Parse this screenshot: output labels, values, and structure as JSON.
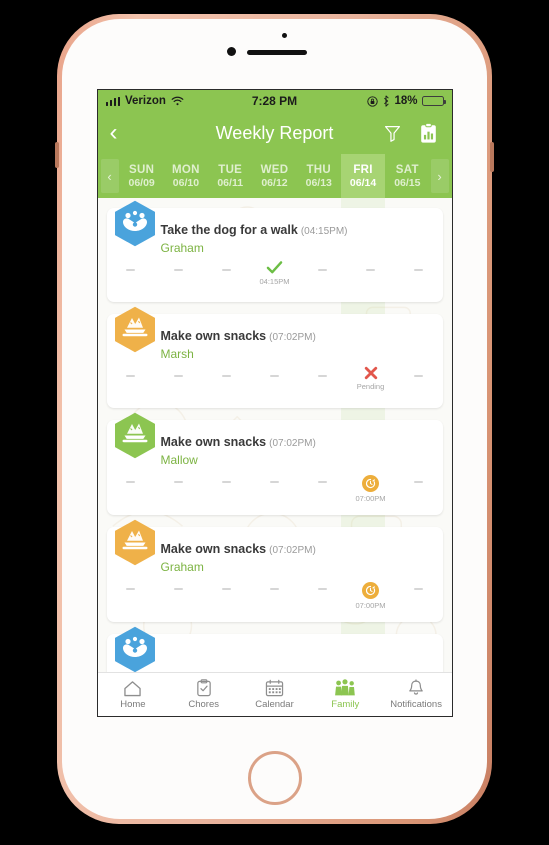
{
  "status_bar": {
    "carrier": "Verizon",
    "time": "7:28 PM",
    "battery_percent": "18%",
    "wifi_icon": "wifi-icon",
    "signal_icon": "signal-bars-icon",
    "rotation_lock_icon": "rotation-lock-icon",
    "bluetooth_icon": "bluetooth-icon",
    "battery_icon": "battery-icon",
    "battery_fill_pct": 18
  },
  "header": {
    "title": "Weekly Report",
    "back_icon": "back-chevron-icon",
    "filter_icon": "filter-funnel-icon",
    "report_icon": "clipboard-chart-icon"
  },
  "date_strip": {
    "prev_icon": "chevron-left-icon",
    "next_icon": "chevron-right-icon",
    "selected_index": 5,
    "days": [
      {
        "dow": "SUN",
        "date": "06/09"
      },
      {
        "dow": "MON",
        "date": "06/10"
      },
      {
        "dow": "TUE",
        "date": "06/11"
      },
      {
        "dow": "WED",
        "date": "06/12"
      },
      {
        "dow": "THU",
        "date": "06/13"
      },
      {
        "dow": "FRI",
        "date": "06/14"
      },
      {
        "dow": "SAT",
        "date": "06/15"
      }
    ]
  },
  "colors": {
    "brand_green": "#8cc551",
    "selected_day": "#a7d473",
    "assignee_green": "#7cb342",
    "check_green": "#6cbe45",
    "pending_red": "#e2574c",
    "clock_orange": "#edae3c",
    "avatar_blue": "#4aa3dc",
    "avatar_orange": "#efb149",
    "avatar_green": "#8cc551"
  },
  "tasks": [
    {
      "name": "Take the dog for a walk",
      "time": "(04:15PM)",
      "assignee": "Graham",
      "avatar_icon": "dog-avatar-icon",
      "avatar_color": "#4aa3dc",
      "cells": [
        {
          "type": "none",
          "label": ""
        },
        {
          "type": "none",
          "label": ""
        },
        {
          "type": "none",
          "label": ""
        },
        {
          "type": "check",
          "label": "04:15PM"
        },
        {
          "type": "none",
          "label": ""
        },
        {
          "type": "none",
          "label": ""
        },
        {
          "type": "none",
          "label": ""
        }
      ]
    },
    {
      "name": "Make own snacks",
      "time": "(07:02PM)",
      "assignee": "Marsh",
      "avatar_icon": "snack-avatar-icon",
      "avatar_color": "#efb149",
      "cells": [
        {
          "type": "none",
          "label": ""
        },
        {
          "type": "none",
          "label": ""
        },
        {
          "type": "none",
          "label": ""
        },
        {
          "type": "none",
          "label": ""
        },
        {
          "type": "none",
          "label": ""
        },
        {
          "type": "pending",
          "label": "Pending"
        },
        {
          "type": "none",
          "label": ""
        }
      ]
    },
    {
      "name": "Make own snacks",
      "time": "(07:02PM)",
      "assignee": "Mallow",
      "avatar_icon": "snack-avatar-icon",
      "avatar_color": "#8cc551",
      "cells": [
        {
          "type": "none",
          "label": ""
        },
        {
          "type": "none",
          "label": ""
        },
        {
          "type": "none",
          "label": ""
        },
        {
          "type": "none",
          "label": ""
        },
        {
          "type": "none",
          "label": ""
        },
        {
          "type": "clock",
          "label": "07:00PM"
        },
        {
          "type": "none",
          "label": ""
        }
      ]
    },
    {
      "name": "Make own snacks",
      "time": "(07:02PM)",
      "assignee": "Graham",
      "avatar_icon": "snack-avatar-icon",
      "avatar_color": "#efb149",
      "cells": [
        {
          "type": "none",
          "label": ""
        },
        {
          "type": "none",
          "label": ""
        },
        {
          "type": "none",
          "label": ""
        },
        {
          "type": "none",
          "label": ""
        },
        {
          "type": "none",
          "label": ""
        },
        {
          "type": "clock",
          "label": "07:00PM"
        },
        {
          "type": "none",
          "label": ""
        }
      ]
    }
  ],
  "partial_task": {
    "avatar_icon": "dog-avatar-icon",
    "avatar_color": "#4aa3dc"
  },
  "tab_bar": {
    "active_index": 3,
    "tabs": [
      {
        "label": "Home",
        "icon": "home-icon"
      },
      {
        "label": "Chores",
        "icon": "clipboard-check-icon"
      },
      {
        "label": "Calendar",
        "icon": "calendar-icon"
      },
      {
        "label": "Family",
        "icon": "family-people-icon"
      },
      {
        "label": "Notifications",
        "icon": "bell-icon"
      }
    ]
  }
}
